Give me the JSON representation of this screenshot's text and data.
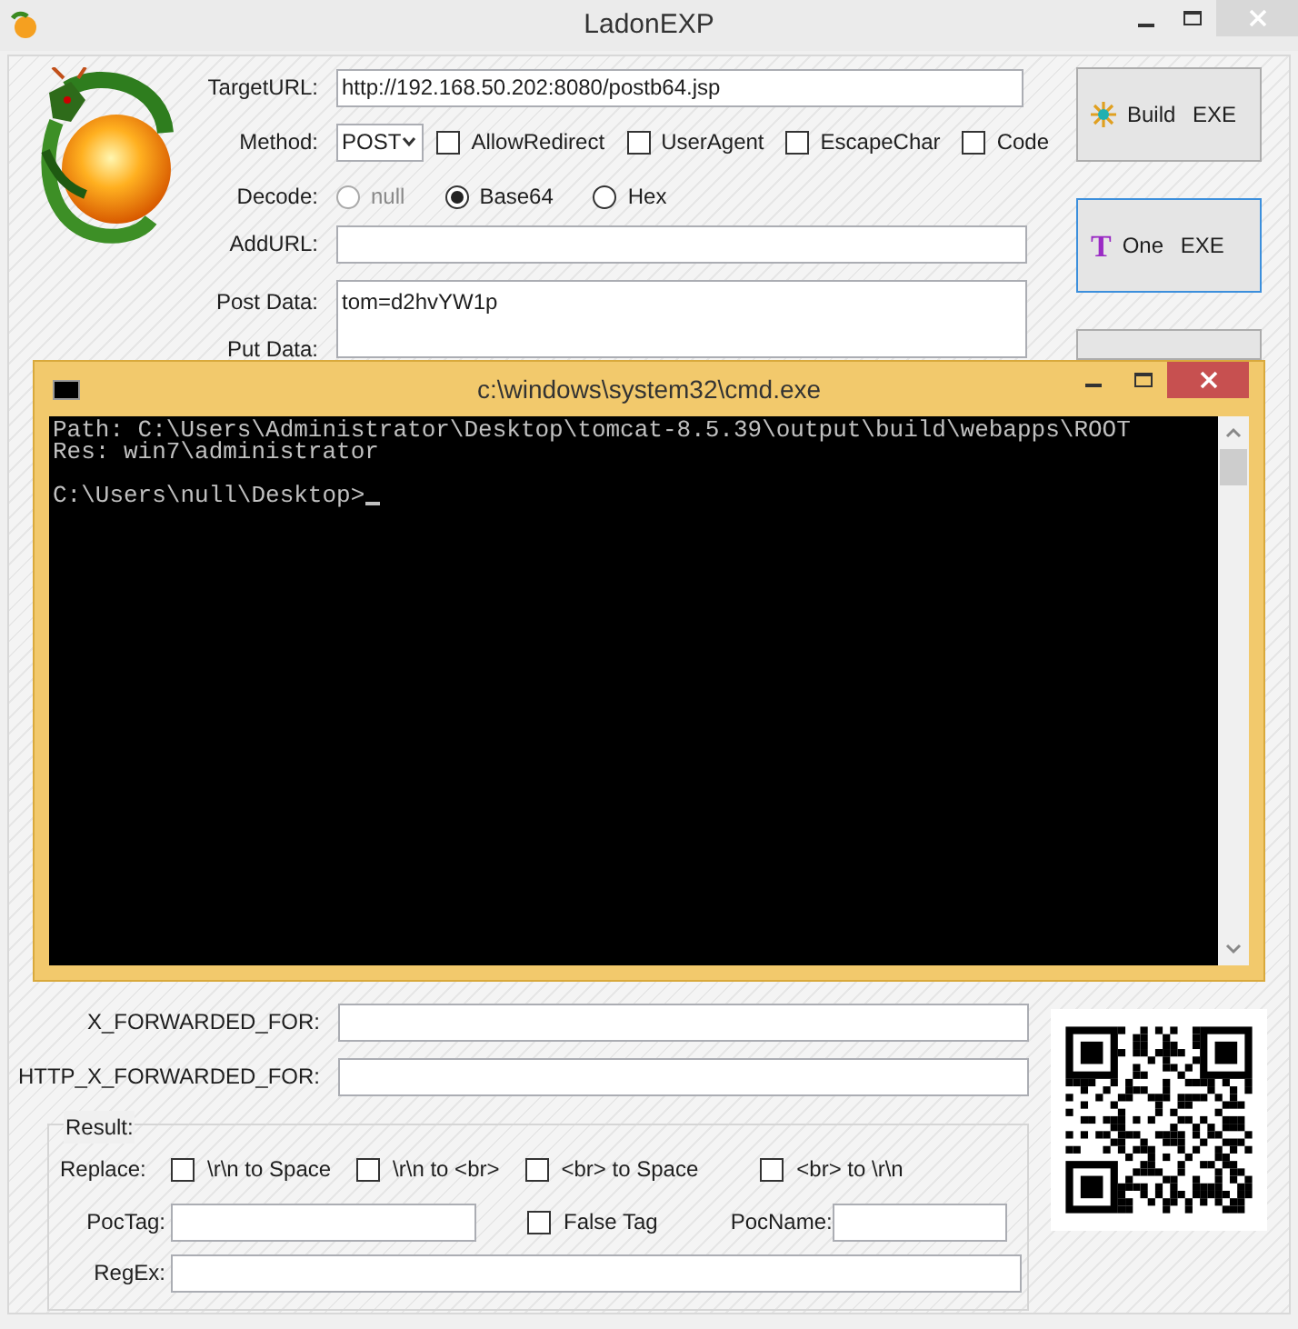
{
  "window": {
    "title": "LadonEXP"
  },
  "form": {
    "target_url": {
      "label": "TargetURL:",
      "value": "http://192.168.50.202:8080/postb64.jsp"
    },
    "method": {
      "label": "Method:",
      "value": "POST"
    },
    "options": [
      {
        "label": "AllowRedirect",
        "checked": false
      },
      {
        "label": "UserAgent",
        "checked": false
      },
      {
        "label": "EscapeChar",
        "checked": false
      },
      {
        "label": "Code",
        "checked": false
      }
    ],
    "decode": {
      "label": "Decode:",
      "options": [
        {
          "label": "null",
          "selected": false,
          "disabled": true
        },
        {
          "label": "Base64",
          "selected": true,
          "disabled": false
        },
        {
          "label": "Hex",
          "selected": false,
          "disabled": false
        }
      ]
    },
    "add_url": {
      "label": "AddURL:"
    },
    "post_data": {
      "label": "Post Data:",
      "value": "tom=d2hvYW1p"
    },
    "put_data": {
      "label": "Put Data:"
    },
    "x_forwarded_for": {
      "label": "X_FORWARDED_FOR:"
    },
    "http_x_forwarded_for": {
      "label": "HTTP_X_FORWARDED_FOR:"
    }
  },
  "buttons": [
    {
      "kind": "star",
      "label": "Build EXE",
      "focused": false
    },
    {
      "kind": "letter",
      "glyph": "T",
      "label": "One EXE",
      "focused": true
    },
    {
      "kind": "blank",
      "focused": false
    }
  ],
  "result": {
    "title": "Result:",
    "replace_label": "Replace:",
    "replace_options": [
      {
        "label": "\\r\\n to Space",
        "checked": false
      },
      {
        "label": "\\r\\n to <br>",
        "checked": false
      },
      {
        "label": "<br> to Space",
        "checked": false
      },
      {
        "label": "<br> to \\r\\n",
        "checked": false
      }
    ],
    "poc_tag": {
      "label": "PocTag:"
    },
    "false_tag": {
      "label": "False Tag",
      "checked": false
    },
    "poc_name": {
      "label": "PocName:"
    },
    "regex": {
      "label": "RegEx:"
    }
  },
  "console": {
    "title": "c:\\windows\\system32\\cmd.exe",
    "output": [
      "Path: C:\\Users\\Administrator\\Desktop\\tomcat-8.5.39\\output\\build\\webapps\\ROOT",
      "Res: win7\\administrator"
    ],
    "prompt": "C:\\Users\\null\\Desktop>"
  }
}
